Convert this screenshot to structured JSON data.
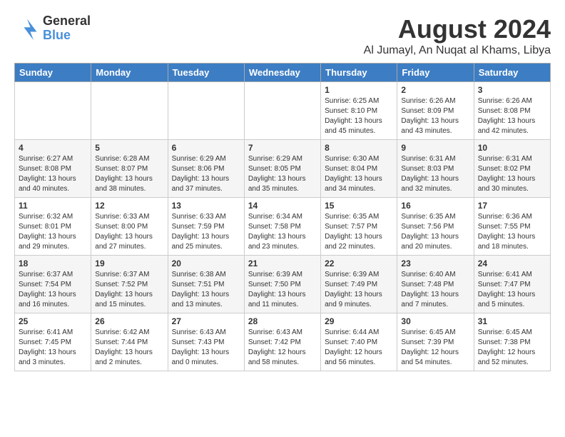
{
  "logo": {
    "general": "General",
    "blue": "Blue"
  },
  "header": {
    "month": "August 2024",
    "location": "Al Jumayl, An Nuqat al Khams, Libya"
  },
  "weekdays": [
    "Sunday",
    "Monday",
    "Tuesday",
    "Wednesday",
    "Thursday",
    "Friday",
    "Saturday"
  ],
  "weeks": [
    [
      {
        "day": "",
        "info": ""
      },
      {
        "day": "",
        "info": ""
      },
      {
        "day": "",
        "info": ""
      },
      {
        "day": "",
        "info": ""
      },
      {
        "day": "1",
        "info": "Sunrise: 6:25 AM\nSunset: 8:10 PM\nDaylight: 13 hours\nand 45 minutes."
      },
      {
        "day": "2",
        "info": "Sunrise: 6:26 AM\nSunset: 8:09 PM\nDaylight: 13 hours\nand 43 minutes."
      },
      {
        "day": "3",
        "info": "Sunrise: 6:26 AM\nSunset: 8:08 PM\nDaylight: 13 hours\nand 42 minutes."
      }
    ],
    [
      {
        "day": "4",
        "info": "Sunrise: 6:27 AM\nSunset: 8:08 PM\nDaylight: 13 hours\nand 40 minutes."
      },
      {
        "day": "5",
        "info": "Sunrise: 6:28 AM\nSunset: 8:07 PM\nDaylight: 13 hours\nand 38 minutes."
      },
      {
        "day": "6",
        "info": "Sunrise: 6:29 AM\nSunset: 8:06 PM\nDaylight: 13 hours\nand 37 minutes."
      },
      {
        "day": "7",
        "info": "Sunrise: 6:29 AM\nSunset: 8:05 PM\nDaylight: 13 hours\nand 35 minutes."
      },
      {
        "day": "8",
        "info": "Sunrise: 6:30 AM\nSunset: 8:04 PM\nDaylight: 13 hours\nand 34 minutes."
      },
      {
        "day": "9",
        "info": "Sunrise: 6:31 AM\nSunset: 8:03 PM\nDaylight: 13 hours\nand 32 minutes."
      },
      {
        "day": "10",
        "info": "Sunrise: 6:31 AM\nSunset: 8:02 PM\nDaylight: 13 hours\nand 30 minutes."
      }
    ],
    [
      {
        "day": "11",
        "info": "Sunrise: 6:32 AM\nSunset: 8:01 PM\nDaylight: 13 hours\nand 29 minutes."
      },
      {
        "day": "12",
        "info": "Sunrise: 6:33 AM\nSunset: 8:00 PM\nDaylight: 13 hours\nand 27 minutes."
      },
      {
        "day": "13",
        "info": "Sunrise: 6:33 AM\nSunset: 7:59 PM\nDaylight: 13 hours\nand 25 minutes."
      },
      {
        "day": "14",
        "info": "Sunrise: 6:34 AM\nSunset: 7:58 PM\nDaylight: 13 hours\nand 23 minutes."
      },
      {
        "day": "15",
        "info": "Sunrise: 6:35 AM\nSunset: 7:57 PM\nDaylight: 13 hours\nand 22 minutes."
      },
      {
        "day": "16",
        "info": "Sunrise: 6:35 AM\nSunset: 7:56 PM\nDaylight: 13 hours\nand 20 minutes."
      },
      {
        "day": "17",
        "info": "Sunrise: 6:36 AM\nSunset: 7:55 PM\nDaylight: 13 hours\nand 18 minutes."
      }
    ],
    [
      {
        "day": "18",
        "info": "Sunrise: 6:37 AM\nSunset: 7:54 PM\nDaylight: 13 hours\nand 16 minutes."
      },
      {
        "day": "19",
        "info": "Sunrise: 6:37 AM\nSunset: 7:52 PM\nDaylight: 13 hours\nand 15 minutes."
      },
      {
        "day": "20",
        "info": "Sunrise: 6:38 AM\nSunset: 7:51 PM\nDaylight: 13 hours\nand 13 minutes."
      },
      {
        "day": "21",
        "info": "Sunrise: 6:39 AM\nSunset: 7:50 PM\nDaylight: 13 hours\nand 11 minutes."
      },
      {
        "day": "22",
        "info": "Sunrise: 6:39 AM\nSunset: 7:49 PM\nDaylight: 13 hours\nand 9 minutes."
      },
      {
        "day": "23",
        "info": "Sunrise: 6:40 AM\nSunset: 7:48 PM\nDaylight: 13 hours\nand 7 minutes."
      },
      {
        "day": "24",
        "info": "Sunrise: 6:41 AM\nSunset: 7:47 PM\nDaylight: 13 hours\nand 5 minutes."
      }
    ],
    [
      {
        "day": "25",
        "info": "Sunrise: 6:41 AM\nSunset: 7:45 PM\nDaylight: 13 hours\nand 3 minutes."
      },
      {
        "day": "26",
        "info": "Sunrise: 6:42 AM\nSunset: 7:44 PM\nDaylight: 13 hours\nand 2 minutes."
      },
      {
        "day": "27",
        "info": "Sunrise: 6:43 AM\nSunset: 7:43 PM\nDaylight: 13 hours\nand 0 minutes."
      },
      {
        "day": "28",
        "info": "Sunrise: 6:43 AM\nSunset: 7:42 PM\nDaylight: 12 hours\nand 58 minutes."
      },
      {
        "day": "29",
        "info": "Sunrise: 6:44 AM\nSunset: 7:40 PM\nDaylight: 12 hours\nand 56 minutes."
      },
      {
        "day": "30",
        "info": "Sunrise: 6:45 AM\nSunset: 7:39 PM\nDaylight: 12 hours\nand 54 minutes."
      },
      {
        "day": "31",
        "info": "Sunrise: 6:45 AM\nSunset: 7:38 PM\nDaylight: 12 hours\nand 52 minutes."
      }
    ]
  ]
}
